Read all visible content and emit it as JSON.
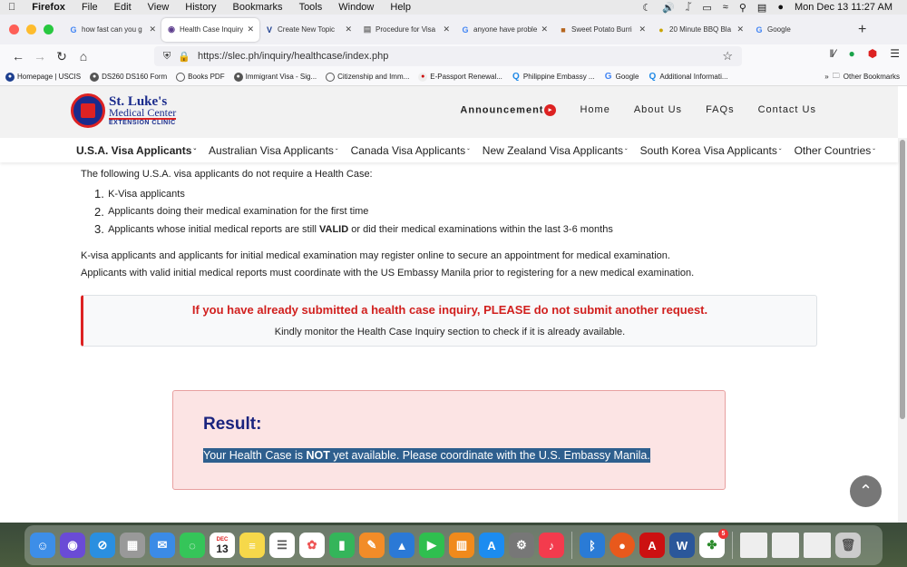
{
  "menubar": {
    "items": [
      "Firefox",
      "File",
      "Edit",
      "View",
      "History",
      "Bookmarks",
      "Tools",
      "Window",
      "Help"
    ],
    "clock": "Mon Dec 13  11:27 AM"
  },
  "tabs": [
    {
      "label": "how fast can you g",
      "icon": "google-icon",
      "active": false
    },
    {
      "label": "Health Case Inquiry",
      "icon": "stlukes-icon",
      "active": true
    },
    {
      "label": "Create New Topic",
      "icon": "vj-icon",
      "active": false
    },
    {
      "label": "Procedure for Visa",
      "icon": "doc-icon",
      "active": false
    },
    {
      "label": "anyone have proble",
      "icon": "google-icon",
      "active": false
    },
    {
      "label": "Sweet Potato Burri",
      "icon": "food-icon",
      "active": false
    },
    {
      "label": "20 Minute BBQ Bla",
      "icon": "food-icon",
      "active": false
    },
    {
      "label": "Google",
      "icon": "google-icon",
      "active": false
    }
  ],
  "url": "https://slec.ph/inquiry/healthcase/index.php",
  "bookmarks": [
    "Homepage | USCIS",
    "DS260 DS160 Form",
    "Books PDF",
    "Immigrant Visa - Sig...",
    "Citizenship and Imm...",
    "E-Passport Renewal...",
    "Philippine Embassy ...",
    "Google",
    "Additional Informati..."
  ],
  "other_bookmarks": "Other Bookmarks",
  "logo": {
    "line1": "St. Luke's",
    "line2": "Medical Center",
    "line3": "EXTENSION CLINIC"
  },
  "topnav": {
    "announcement": "Announcement",
    "home": "Home",
    "about": "About Us",
    "faqs": "FAQs",
    "contact": "Contact Us"
  },
  "mainmenu": [
    "U.S.A. Visa Applicants",
    "Australian Visa Applicants",
    "Canada Visa Applicants",
    "New Zealand Visa Applicants",
    "South Korea Visa Applicants",
    "Other Countries"
  ],
  "content": {
    "intro": "The following U.S.A. visa applicants do not require a Health Case:",
    "list": [
      {
        "num": "1.",
        "text": "K-Visa applicants"
      },
      {
        "num": "2.",
        "text": "Applicants doing their medical examination for the first time"
      },
      {
        "num": "3.",
        "pre": "Applicants whose initial medical reports are still ",
        "bold": "VALID",
        "post": " or did their medical examinations within the last 3-6 months"
      }
    ],
    "note1": "K-visa applicants and applicants for initial medical examination may register online to secure an appointment for medical examination.",
    "note2": "Applicants with valid initial medical reports must coordinate with the US Embassy Manila prior to registering for a new medical examination.",
    "alert_heading": "If you have already submitted a health case inquiry, PLEASE do not submit another request.",
    "alert_sub": "Kindly monitor the Health Case Inquiry section to check if it is already available.",
    "result_title": "Result:",
    "result_pre": "Your Health Case is ",
    "result_bold": "NOT",
    "result_post": " yet available. Please coordinate with the U.S. Embassy Manila."
  },
  "dock": {
    "calendar_month": "DEC",
    "calendar_day": "13",
    "badge": "5"
  }
}
